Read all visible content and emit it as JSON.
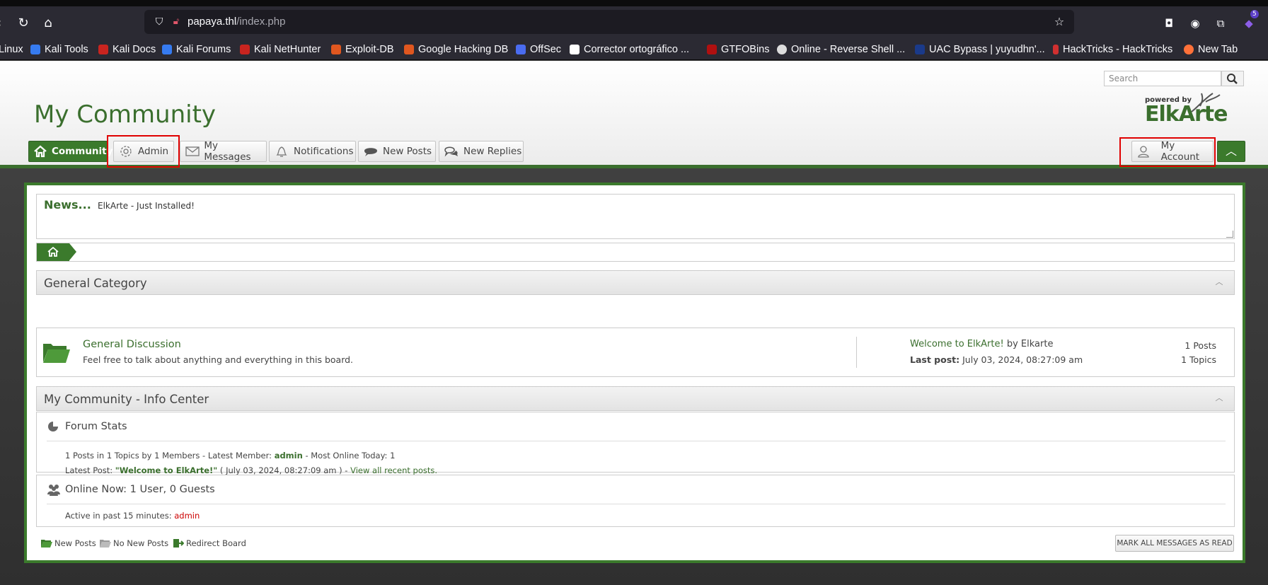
{
  "browser": {
    "url_host": "papaya.thl",
    "url_path": "/index.php",
    "extensions_badge": "5",
    "bookmarks": [
      {
        "label": "Linux",
        "color": "#2b2a33"
      },
      {
        "label": "Kali Tools",
        "color": "#367bf0"
      },
      {
        "label": "Kali Docs",
        "color": "#c9241f"
      },
      {
        "label": "Kali Forums",
        "color": "#367bf0"
      },
      {
        "label": "Kali NetHunter",
        "color": "#c9241f"
      },
      {
        "label": "Exploit-DB",
        "color": "#e0571f"
      },
      {
        "label": "Google Hacking DB",
        "color": "#e0571f"
      },
      {
        "label": "OffSec",
        "color": "#4a6cf0"
      },
      {
        "label": "Corrector ortográfico ...",
        "color": "#ffffff"
      },
      {
        "label": "GTFOBins",
        "color": "#b01010"
      },
      {
        "label": "Online - Reverse Shell ...",
        "color": "#dddddd"
      },
      {
        "label": "UAC Bypass | yuyudhn'...",
        "color": "#1a3a8a"
      },
      {
        "label": "HackTricks - HackTricks",
        "color": "#d03030"
      },
      {
        "label": "New Tab",
        "color": "#ff7139"
      }
    ]
  },
  "header": {
    "search_placeholder": "Search",
    "site_title": "My Community",
    "logo_powered": "powered by",
    "logo_name": "ElkArte",
    "nav": {
      "community": "Community",
      "admin": "Admin",
      "messages": "My Messages",
      "notifications": "Notifications",
      "new_posts": "New Posts",
      "new_replies": "New Replies",
      "my_account": "My Account"
    }
  },
  "news": {
    "title": "News...",
    "text": "ElkArte - Just Installed!"
  },
  "category": {
    "title": "General Category",
    "board": {
      "name": "General Discussion",
      "description": "Feel free to talk about anything and everything in this board.",
      "last_post_title": "Welcome to ElkArte!",
      "last_post_by_prefix": "by",
      "last_post_author": "Elkarte",
      "last_post_label": "Last post:",
      "last_post_date": "July 03, 2024, 08:27:09 am",
      "posts": "1 Posts",
      "topics": "1 Topics"
    }
  },
  "info_center": {
    "title": "My Community - Info Center",
    "forum_stats_title": "Forum Stats",
    "stats_line1_prefix": "1 Posts in 1 Topics by 1 Members - Latest Member:",
    "latest_member": "admin",
    "stats_line1_suffix": "- Most Online Today: 1",
    "latest_post_label": "Latest Post:",
    "latest_post_title": "\"Welcome to ElkArte!\"",
    "latest_post_date": "( July 03, 2024, 08:27:09 am ) -",
    "view_recent": "View all recent posts.",
    "online_title": "Online Now: 1 User, 0 Guests",
    "active_label": "Active in past 15 minutes:",
    "active_user": "admin"
  },
  "legend": {
    "new_posts": "New Posts",
    "no_new_posts": "No New Posts",
    "redirect_board": "Redirect Board"
  },
  "mark_all_read": "MARK ALL MESSAGES AS READ"
}
